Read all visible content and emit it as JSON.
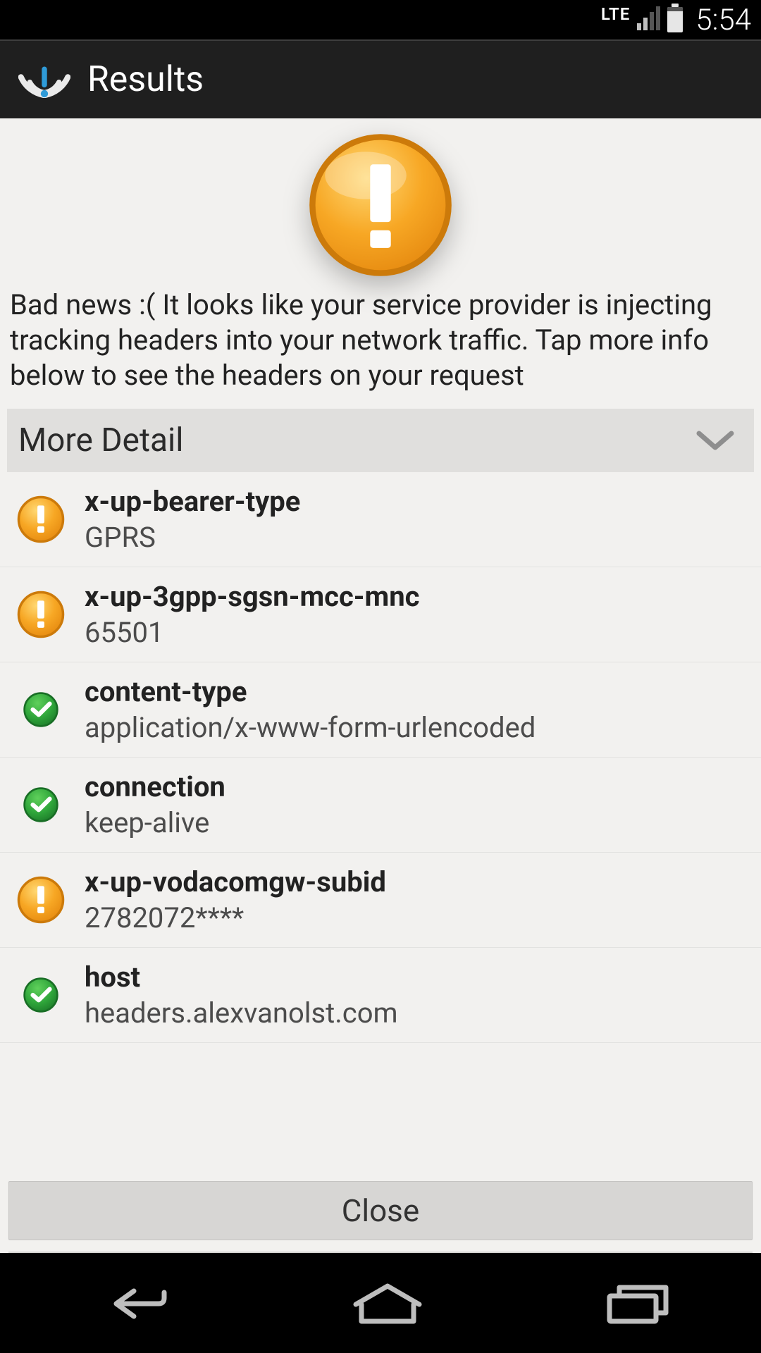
{
  "statusbar": {
    "network_label": "LTE",
    "time": "5:54"
  },
  "actionbar": {
    "title": "Results"
  },
  "warning": {
    "icon": "exclamation-warning-icon",
    "message": "Bad news :( It looks like your service provider is injecting tracking headers into your network traffic. Tap more info below to see the headers on your request"
  },
  "expander": {
    "label": "More Detail"
  },
  "headers": [
    {
      "status": "warn",
      "name": "x-up-bearer-type",
      "value": "GPRS"
    },
    {
      "status": "warn",
      "name": "x-up-3gpp-sgsn-mcc-mnc",
      "value": "65501"
    },
    {
      "status": "ok",
      "name": "content-type",
      "value": "application/x-www-form-urlencoded"
    },
    {
      "status": "ok",
      "name": "connection",
      "value": "keep-alive"
    },
    {
      "status": "warn",
      "name": "x-up-vodacomgw-subid",
      "value": "2782072****"
    },
    {
      "status": "ok",
      "name": "host",
      "value": "headers.alexvanolst.com"
    }
  ],
  "buttons": {
    "close": "Close"
  }
}
